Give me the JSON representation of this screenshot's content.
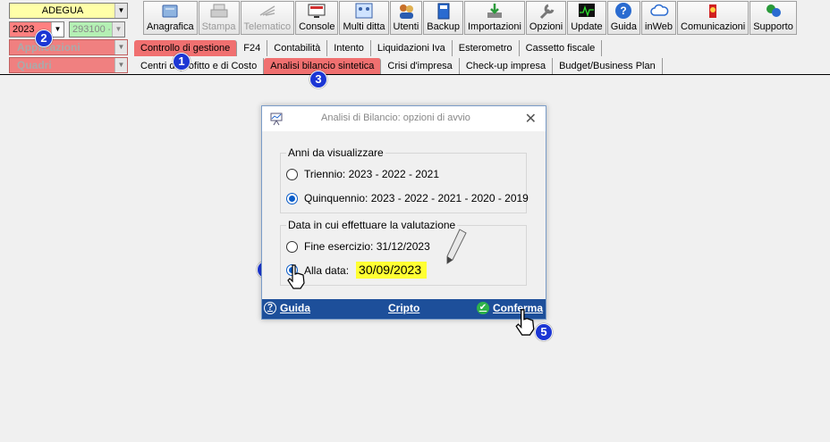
{
  "selectors": {
    "mode": "ADEGUA",
    "year": "2023",
    "code": "293100 -",
    "applications": "Applicazioni",
    "quadri": "Quadri"
  },
  "toolbar": {
    "items": [
      {
        "label": "Anagrafica",
        "icon": "folder-notebook-icon",
        "enabled": true
      },
      {
        "label": "Stampa",
        "icon": "printer-icon",
        "enabled": false
      },
      {
        "label": "Telematico",
        "icon": "telematic-send-icon",
        "enabled": false
      },
      {
        "label": "Console",
        "icon": "monitor-console-icon",
        "enabled": true
      },
      {
        "label": "Multi ditta",
        "icon": "multi-company-icon",
        "enabled": true
      },
      {
        "label": "Utenti",
        "icon": "users-icon",
        "enabled": true
      },
      {
        "label": "Backup",
        "icon": "backup-disk-icon",
        "enabled": true
      },
      {
        "label": "Importazioni",
        "icon": "import-download-icon",
        "enabled": true
      },
      {
        "label": "Opzioni",
        "icon": "wrench-icon",
        "enabled": true
      },
      {
        "label": "Update",
        "icon": "update-monitor-icon",
        "enabled": true
      },
      {
        "label": "Guida",
        "icon": "help-question-icon",
        "enabled": true
      },
      {
        "label": "inWeb",
        "icon": "cloud-icon",
        "enabled": true
      },
      {
        "label": "Comunicazioni",
        "icon": "communications-icon",
        "enabled": true
      },
      {
        "label": "Supporto",
        "icon": "support-icon",
        "enabled": true
      }
    ]
  },
  "tabs_top": [
    "Controllo di gestione",
    "F24",
    "Contabilità",
    "Intento",
    "Liquidazioni Iva",
    "Esterometro",
    "Cassetto fiscale"
  ],
  "tabs_top_active": 0,
  "tabs_bottom": [
    "Centri di profitto e di Costo",
    "Analisi bilancio sintetica",
    "Crisi d'impresa",
    "Check-up impresa",
    "Budget/Business Plan"
  ],
  "tabs_bottom_active": 1,
  "steps": [
    "1",
    "2",
    "3",
    "4",
    "5"
  ],
  "dialog": {
    "title": "Analisi di Bilancio: opzioni di avvio",
    "close": "✕",
    "group_years": {
      "legend": "Anni da visualizzare",
      "options": [
        "Triennio: 2023 - 2022 - 2021",
        "Quinquennio: 2023 - 2022 - 2021 - 2020 - 2019"
      ],
      "selected": 1
    },
    "group_date": {
      "legend": "Data in cui effettuare la valutazione",
      "option_end": "Fine esercizio: 31/12/2023",
      "option_date": "Alla data:",
      "date_value": "30/09/2023",
      "selected": 1
    },
    "footer": {
      "guide": "Guida",
      "cripto": "Cripto",
      "confirm": "Conferma"
    }
  },
  "colors": {
    "active_tab": "#f07070",
    "footer_bg": "#1d4f9a",
    "step_marker": "#1c36d4",
    "date_highlight": "#ffff33"
  }
}
